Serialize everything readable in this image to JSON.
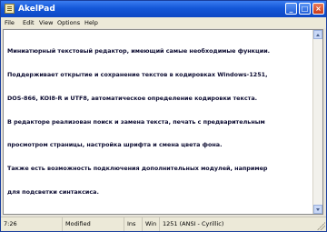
{
  "window": {
    "title": "AkelPad",
    "controls": {
      "minimize": "_",
      "maximize": "□",
      "close": "×"
    }
  },
  "menu": {
    "items": [
      "File",
      "Edit",
      "View",
      "Options",
      "Help"
    ]
  },
  "editor": {
    "lines": [
      "Миниатюрный текстовый редактор, имеющий самые необходимые функции.",
      "Поддерживает открытие и сохранение текстов в кодировках Windows-1251,",
      "DOS-866, KOI8-R и UTF8, автоматическое определение кодировки текста.",
      "В редакторе реализован поиск и замена текста, печать с предварительным",
      "просмотром страницы, настройка шрифта и смена цвета фона.",
      "Также есть возможность подключения дополнительных модулей, например",
      "для подсветки синтаксиса."
    ]
  },
  "status": {
    "position": "7:26",
    "modified": "Modified",
    "insert": "Ins",
    "newline": "Win",
    "encoding": "1251  (ANSI - Cyrillic)"
  },
  "colors": {
    "titlebar": "#1457d8",
    "menubar": "#ece9d8",
    "editor_bg": "#ffffff",
    "editor_text": "#0a0a30"
  },
  "icons": {
    "app": "notepad-icon",
    "resize": "resize-grip-icon"
  }
}
